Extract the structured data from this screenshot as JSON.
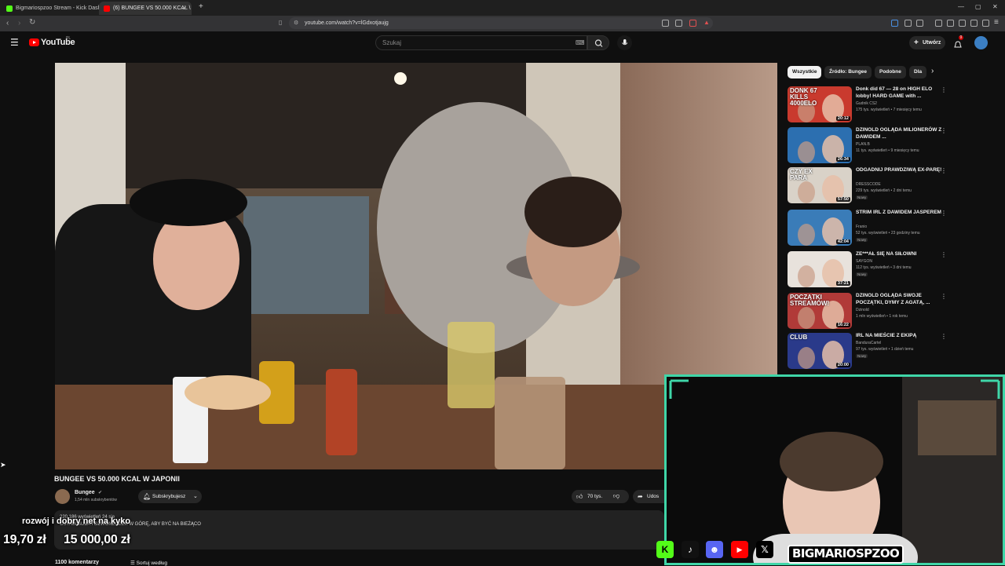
{
  "browser": {
    "tabs": [
      {
        "label": "Bigmariospzoo Stream - Kick Dashbo",
        "active": false
      },
      {
        "label": "(6) BUNGEE VS 50.000 KCAL \\",
        "active": true
      }
    ],
    "url": "youtube.com/watch?v=lGdxotjaujg"
  },
  "youtube": {
    "logo": "YouTube",
    "country": "PL",
    "search_placeholder": "Szukaj",
    "create_label": "Utwórz",
    "notification_count": "9"
  },
  "video": {
    "title": "BUNGEE VS 50.000 KCAL W JAPONII",
    "channel": "Bungee",
    "subscribers": "1,54 mln subskrybentów",
    "subscribe_label": "Subskrybujesz",
    "likes": "70 tys.",
    "share_label": "Udos",
    "views_line": "220 186 wyświetleń 24 sie",
    "desc_line": "OSTAW SUBA I DZWONECZEK W GÓRĘ, ABY BYĆ NA BIEŻĄCO",
    "comments": "1100 komentarzy",
    "sort_label": "Sortuj według"
  },
  "chips": [
    {
      "label": "Wszystkie",
      "selected": true
    },
    {
      "label": "Źródło: Bungee",
      "selected": false
    },
    {
      "label": "Podobne",
      "selected": false
    },
    {
      "label": "Dla",
      "selected": false
    }
  ],
  "recommendations": [
    {
      "title": "Donk did 67 — 28 on HIGH ELO lobby! HARD GAME with ...",
      "channel": "Gudnik CS2",
      "meta": "175 tys. wyświetleń • 7 miesięcy temu",
      "duration": "20:12",
      "badge": "",
      "thumb_text": "DONK 67 KILLS 4000ELO",
      "thumb_color": "#c93a2e"
    },
    {
      "title": "DZINOLD OGLĄDA MILIONERÓW Z DAWIDEM ...",
      "channel": "PLAN.B",
      "meta": "11 tys. wyświetleń • 9 miesięcy temu",
      "duration": "26:34",
      "badge": "",
      "thumb_text": "",
      "thumb_color": "#2c6fb0"
    },
    {
      "title": "ODGADNIJ PRAWDZIWĄ EX-PARĘ!",
      "channel": "DRESSCODE",
      "meta": "229 tys. wyświetleń • 2 dni temu",
      "duration": "57:50",
      "badge": "Nowy",
      "thumb_text": "CZY EX PARA",
      "thumb_color": "#d9d2c8"
    },
    {
      "title": "STRIM IRL Z DAWIDEM JASPEREM",
      "channel": "Franio",
      "meta": "52 tys. wyświetleń • 23 godziny temu",
      "duration": "42:04",
      "badge": "Nowy",
      "thumb_text": "",
      "thumb_color": "#3a7cb8"
    },
    {
      "title": "ZE***AŁ SIĘ NA SIŁOWNI",
      "channel": "SAYGON",
      "meta": "112 tys. wyświetleń • 3 dni temu",
      "duration": "37:21",
      "badge": "Nowy",
      "thumb_text": "",
      "thumb_color": "#e8e2dc"
    },
    {
      "title": "DZINOLD OGLĄDA SWOJE POCZĄTKI, DYMY Z AGATĄ, ...",
      "channel": "Dzinold",
      "meta": "1 mln wyświetleń • 1 rok temu",
      "duration": "16:22",
      "badge": "",
      "thumb_text": "POCZĄTKI STREAMÓW!",
      "thumb_color": "#b13a38"
    },
    {
      "title": "IRL NA MIEŚCIE Z EKIPĄ",
      "channel": "BandurаCartel",
      "meta": "97 tys. wyświetleń • 1 dzień temu",
      "duration": "20:00",
      "badge": "Nowy",
      "thumb_text": "CLUB",
      "thumb_color": "#2a3a8a"
    }
  ],
  "overlay": {
    "goal_label": "rozwój i dobry net na kyko",
    "goal_progress": "19,70 zł",
    "goal_target": "15 000,00 zł",
    "streamer_name": "BIGMARIOSPZOO",
    "socials": [
      "kick-icon",
      "tiktok-icon",
      "discord-icon",
      "youtube-icon",
      "x-icon"
    ],
    "accent": "#3fd6a8"
  }
}
